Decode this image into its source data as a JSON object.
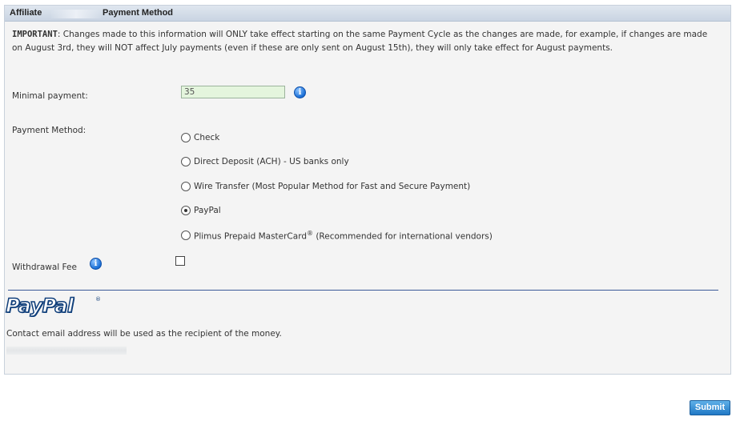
{
  "header": {
    "affiliate_label": "Affiliate",
    "title": "Payment Method"
  },
  "notice": {
    "bold_prefix": "IMPORTANT",
    "text": ": Changes made to this information will ONLY take effect starting on the same Payment Cycle as the changes are made, for example, if changes are made on August 3rd, they will NOT affect July payments (even if these are only sent on August 15th), they will only take effect for August payments."
  },
  "minimal_payment": {
    "label": "Minimal payment:",
    "value": "35"
  },
  "payment_method": {
    "label": "Payment Method:",
    "options": [
      {
        "label": "Check",
        "selected": false
      },
      {
        "label": "Direct Deposit (ACH) - US banks only",
        "selected": false
      },
      {
        "label": "Wire Transfer (Most Popular Method for Fast and Secure Payment)",
        "selected": false
      },
      {
        "label": "PayPal",
        "selected": true
      },
      {
        "label": "Plimus Prepaid MasterCard",
        "superscript": "®",
        "suffix": " (Recommended for international vendors)",
        "selected": false
      }
    ]
  },
  "withdrawal_fee": {
    "label": "Withdrawal Fee",
    "checked": false
  },
  "paypal": {
    "logo_text": "PayPal",
    "registered_mark": "®",
    "contact_note": "Contact email address will be used as the recipient of the money."
  },
  "actions": {
    "submit_label": "Submit"
  },
  "icons": {
    "info": "info-icon",
    "info_glyph": "i"
  },
  "colors": {
    "header_bg": "#c9d4e2",
    "panel_bg": "#f4f4f4",
    "input_bg": "#e4f5dd",
    "divider": "#3b5998",
    "submit_bg": "#2078c5",
    "paypal_blue": "#0f3e7a"
  }
}
